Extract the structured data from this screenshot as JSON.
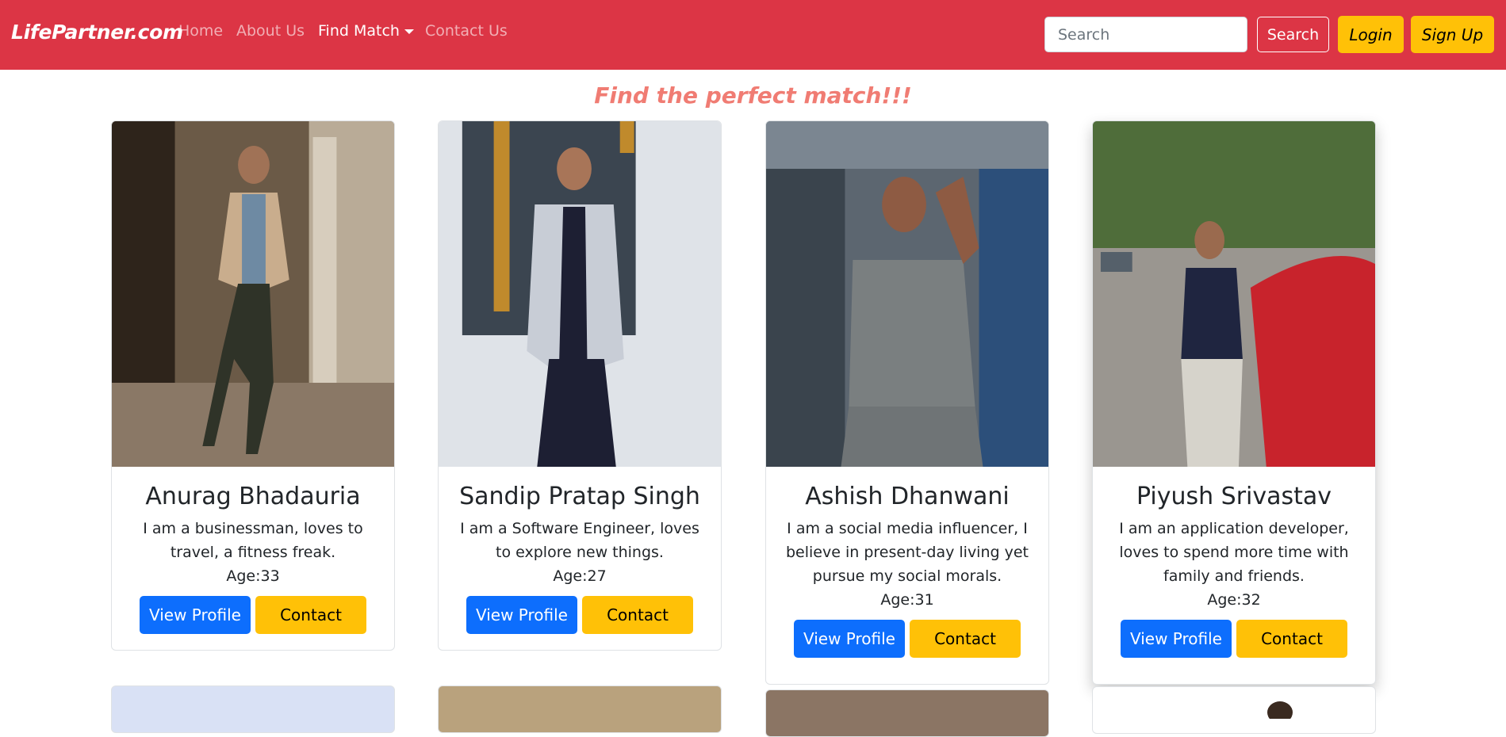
{
  "navbar": {
    "brand": "LifePartner.com",
    "links": [
      "Home",
      "About Us",
      "Find Match",
      "Contact Us"
    ],
    "search_placeholder": "Search",
    "search_button": "Search",
    "login": "Login",
    "signup": "Sign Up"
  },
  "tagline": "Find the perfect match!!!",
  "profiles": [
    {
      "name": "Anurag Bhadauria",
      "bio": "I am a businessman, loves to travel, a fitness freak.",
      "age": "Age:33",
      "view": "View Profile",
      "contact": "Contact"
    },
    {
      "name": "Sandip Pratap Singh",
      "bio": "I am a Software Engineer, loves to explore new things.",
      "age": "Age:27",
      "view": "View Profile",
      "contact": "Contact"
    },
    {
      "name": "Ashish Dhanwani",
      "bio": "I am a social media influencer, I believe in present-day living yet pursue my social morals.",
      "age": "Age:31",
      "view": "View Profile",
      "contact": "Contact"
    },
    {
      "name": "Piyush Srivastav",
      "bio": "I am an application developer, loves to spend more time with family and friends.",
      "age": "Age:32",
      "view": "View Profile",
      "contact": "Contact"
    }
  ],
  "colors": {
    "navbar": "#dc3545",
    "tagline": "#f07c73",
    "primary": "#0d6efd",
    "warning": "#ffc107"
  }
}
